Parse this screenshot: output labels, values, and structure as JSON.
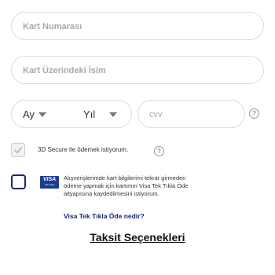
{
  "form": {
    "card_number_placeholder": "Kart Numarası",
    "card_name_placeholder": "Kart Üzerindeki İsim",
    "month_label": "Ay",
    "year_label": "Yıl",
    "cvv_placeholder": "cvv",
    "help_glyph": "?"
  },
  "secure3d": {
    "checked": true,
    "label": "3D Secure ile ödemek istiyorum."
  },
  "visa": {
    "checked": false,
    "logo_text": "VISA",
    "logo_subtext": "Tek Tıkla",
    "description": "Alışverişlerimde kart bilgilerimi tekrar girmeden ödeme yapmak için kartımın Visa Tek Tıkla Öde altyapısına kaydedilmesini istiyorum.",
    "link_text": "Visa Tek Tıkla Öde nedir?"
  },
  "installments": {
    "title": "Taksit Seçenekleri"
  },
  "colors": {
    "accent": "#1a237e",
    "border": "#dcdcdc",
    "placeholder": "#a9a9a9"
  }
}
